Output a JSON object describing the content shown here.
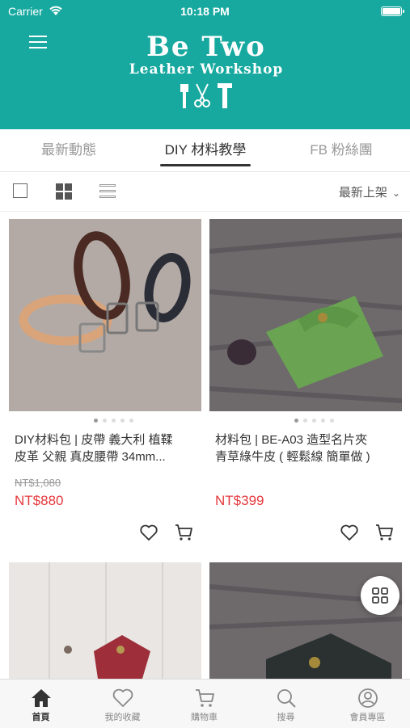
{
  "status_bar": {
    "carrier": "Carrier",
    "time": "10:18 PM"
  },
  "header": {
    "brand_line1": "Be Two",
    "brand_line2": "Leather Workshop"
  },
  "tabs": [
    {
      "label": "最新動態",
      "active": false
    },
    {
      "label": "DIY 材料教學",
      "active": true
    },
    {
      "label": "FB 粉絲團",
      "active": false
    }
  ],
  "toolbar": {
    "sort_label": "最新上架"
  },
  "products": [
    {
      "name_line1": "DIY材料包 | 皮帶 義大利 植鞣",
      "name_line2": "皮革 父親 真皮腰帶 34mm...",
      "old_price": "NT$1,080",
      "price": "NT$880"
    },
    {
      "name_line1": "材料包 | BE-A03 造型名片夾",
      "name_line2": "青草綠牛皮 ( 輕鬆線 簡單做 )",
      "old_price": "",
      "price": "NT$399"
    }
  ],
  "bottom_nav": [
    {
      "label": "首頁",
      "icon": "home-icon",
      "active": true
    },
    {
      "label": "我的收藏",
      "icon": "heart-icon",
      "active": false
    },
    {
      "label": "購物車",
      "icon": "cart-icon",
      "active": false
    },
    {
      "label": "搜尋",
      "icon": "search-icon",
      "active": false
    },
    {
      "label": "會員專區",
      "icon": "member-icon",
      "active": false
    }
  ],
  "colors": {
    "brand": "#17a99f",
    "price": "#e5393d"
  }
}
